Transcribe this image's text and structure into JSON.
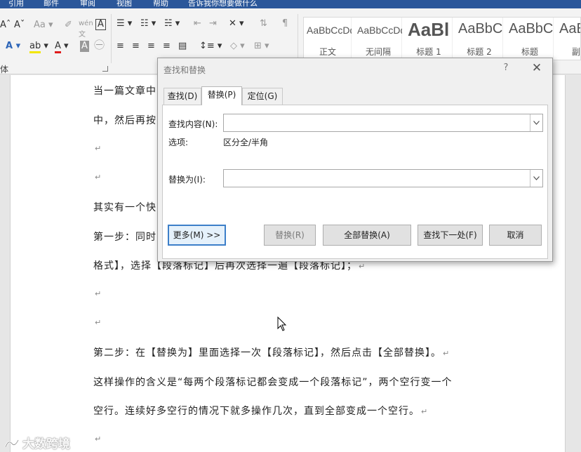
{
  "titlebar": {
    "items": [
      "引用",
      "邮件",
      "审阅",
      "视图",
      "帮助",
      "告诉我你想要做什么"
    ]
  },
  "ribbon": {
    "group_label": "体",
    "styles": [
      {
        "sample": "AaBbCcDd",
        "name": "正文"
      },
      {
        "sample": "AaBbCcDd",
        "name": "无间隔"
      },
      {
        "sample": "AaBl",
        "name": "标题 1"
      },
      {
        "sample": "AaBbC",
        "name": "标题 2"
      },
      {
        "sample": "AaBbC",
        "name": "标题"
      },
      {
        "sample": "AaB",
        "name": "副标"
      }
    ]
  },
  "document": {
    "lines": [
      "当一篇文章中",
      "中，然后再按",
      "",
      "",
      "其实有一个快",
      "第一步：同时",
      "格式】，选择【段落标记】后再次选择一遍【段落标记】；",
      "",
      "",
      "第二步：在【替换为】里面选择一次【段落标记】，然后点击【全部替换】。",
      "这样操作的含义是“每两个段落标记都会变成一个段落标记”，两个空行变一个",
      "空行。连续好多空行的情况下就多操作几次，直到全部变成一个空行。",
      ""
    ],
    "para_mark": "↵",
    "watermark": "大数跨境"
  },
  "dialog": {
    "title": "查找和替换",
    "help": "?",
    "close": "✕",
    "tabs": [
      "查找(D)",
      "替换(P)",
      "定位(G)"
    ],
    "find_label": "查找内容(N):",
    "find_value": "",
    "options_label": "选项:",
    "options_value": "区分全/半角",
    "replace_label": "替换为(I):",
    "replace_value": "",
    "buttons": {
      "more": "更多(M) >>",
      "replace": "替换(R)",
      "replace_all": "全部替换(A)",
      "find_next": "查找下一处(F)",
      "cancel": "取消"
    }
  }
}
